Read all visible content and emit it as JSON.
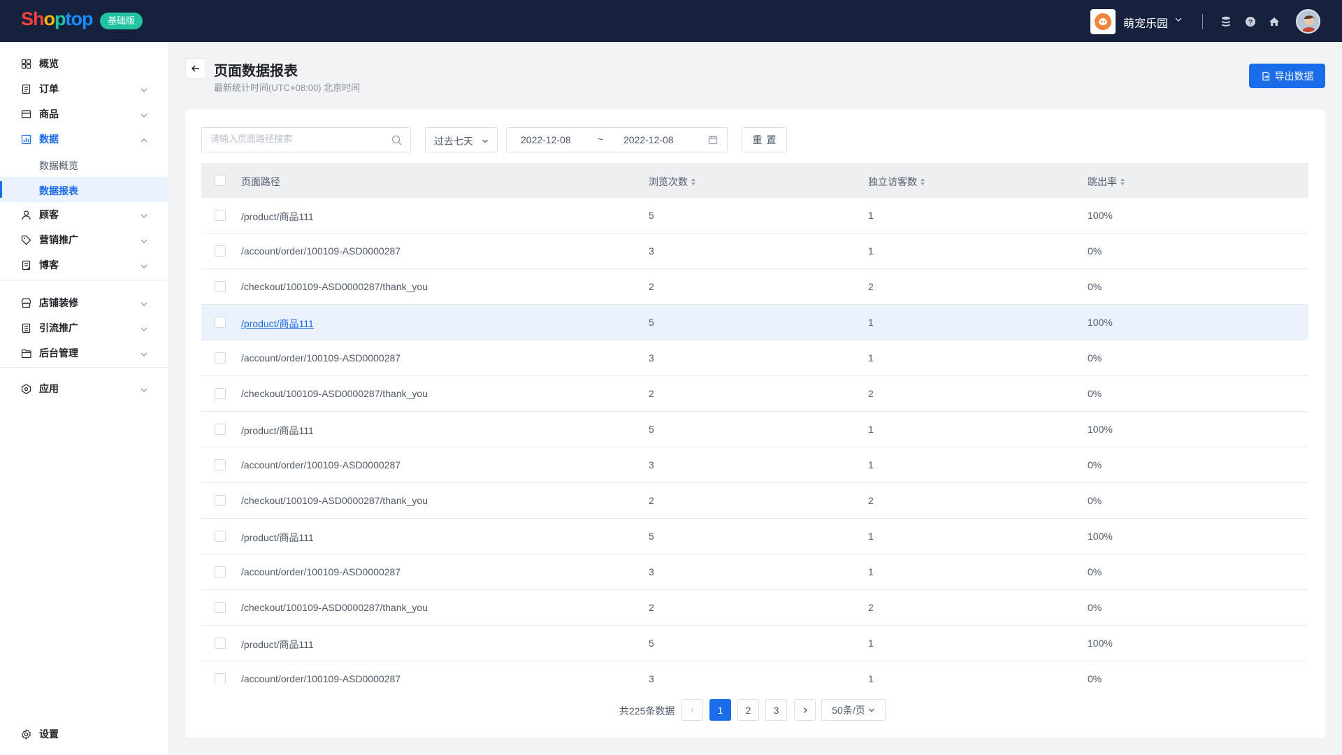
{
  "brand": {
    "letters": [
      {
        "ch": "S",
        "color": "#f5413e"
      },
      {
        "ch": "h",
        "color": "#f5413e"
      },
      {
        "ch": "o",
        "color": "#ffb600"
      },
      {
        "ch": "p",
        "color": "#22c3a0"
      },
      {
        "ch": "t",
        "color": "#1a8cff"
      },
      {
        "ch": "o",
        "color": "#1a8cff"
      },
      {
        "ch": "p",
        "color": "#1a8cff"
      }
    ],
    "plan_badge": "基础版"
  },
  "header": {
    "store_name": "萌宠乐园",
    "icons": [
      "database-icon",
      "help-icon",
      "home-icon"
    ]
  },
  "sidebar": {
    "items": [
      {
        "key": "overview",
        "label": "概览",
        "icon": "dashboard-icon",
        "has_children": false
      },
      {
        "key": "orders",
        "label": "订单",
        "icon": "order-icon",
        "has_children": true
      },
      {
        "key": "products",
        "label": "商品",
        "icon": "product-icon",
        "has_children": true
      },
      {
        "key": "data",
        "label": "数据",
        "icon": "chart-icon",
        "has_children": true,
        "expanded": true,
        "active": true
      },
      {
        "key": "customers",
        "label": "顾客",
        "icon": "user-icon",
        "has_children": true
      },
      {
        "key": "marketing",
        "label": "营销推广",
        "icon": "tag-icon",
        "has_children": true
      },
      {
        "key": "blog",
        "label": "博客",
        "icon": "blog-icon",
        "has_children": true
      },
      {
        "key": "store_design",
        "label": "店铺装修",
        "icon": "store-icon",
        "has_children": true
      },
      {
        "key": "traffic",
        "label": "引流推广",
        "icon": "traffic-icon",
        "has_children": true
      },
      {
        "key": "admin",
        "label": "后台管理",
        "icon": "folder-icon",
        "has_children": true
      },
      {
        "key": "apps",
        "label": "应用",
        "icon": "app-icon",
        "has_children": true
      }
    ],
    "data_children": [
      {
        "label": "数据概览",
        "selected": false
      },
      {
        "label": "数据报表",
        "selected": true
      }
    ],
    "settings_label": "设置"
  },
  "page": {
    "title": "页面数据报表",
    "subtitle": "最新统计时间(UTC+08:00) 北京时间",
    "export_label": "导出数据"
  },
  "filters": {
    "search_placeholder": "请输入页面路径搜索",
    "search_value": "",
    "range_label": "过去七天",
    "date_start": "2022-12-08",
    "date_sep": "~",
    "date_end": "2022-12-08",
    "reset_label": "重置"
  },
  "table": {
    "columns": [
      "页面路径",
      "浏览次数",
      "独立访客数",
      "跳出率"
    ],
    "hover_row": 3,
    "rows": [
      {
        "path": "/product/商品111",
        "views": "5",
        "visitors": "1",
        "bounce": "100%"
      },
      {
        "path": "/account/order/100109-ASD0000287",
        "views": "3",
        "visitors": "1",
        "bounce": "0%"
      },
      {
        "path": "/checkout/100109-ASD0000287/thank_you",
        "views": "2",
        "visitors": "2",
        "bounce": "0%"
      },
      {
        "path": "/product/商品111",
        "views": "5",
        "visitors": "1",
        "bounce": "100%"
      },
      {
        "path": "/account/order/100109-ASD0000287",
        "views": "3",
        "visitors": "1",
        "bounce": "0%"
      },
      {
        "path": "/checkout/100109-ASD0000287/thank_you",
        "views": "2",
        "visitors": "2",
        "bounce": "0%"
      },
      {
        "path": "/product/商品111",
        "views": "5",
        "visitors": "1",
        "bounce": "100%"
      },
      {
        "path": "/account/order/100109-ASD0000287",
        "views": "3",
        "visitors": "1",
        "bounce": "0%"
      },
      {
        "path": "/checkout/100109-ASD0000287/thank_you",
        "views": "2",
        "visitors": "2",
        "bounce": "0%"
      },
      {
        "path": "/product/商品111",
        "views": "5",
        "visitors": "1",
        "bounce": "100%"
      },
      {
        "path": "/account/order/100109-ASD0000287",
        "views": "3",
        "visitors": "1",
        "bounce": "0%"
      },
      {
        "path": "/checkout/100109-ASD0000287/thank_you",
        "views": "2",
        "visitors": "2",
        "bounce": "0%"
      },
      {
        "path": "/product/商品111",
        "views": "5",
        "visitors": "1",
        "bounce": "100%"
      },
      {
        "path": "/account/order/100109-ASD0000287",
        "views": "3",
        "visitors": "1",
        "bounce": "0%"
      }
    ]
  },
  "pagination": {
    "total_label": "共225条数据",
    "pages": [
      "1",
      "2",
      "3"
    ],
    "current": "1",
    "page_size_label": "50条/页"
  },
  "colors": {
    "accent": "#1a6ce8",
    "topbar": "#16223d",
    "badge": "#22c3a0"
  }
}
